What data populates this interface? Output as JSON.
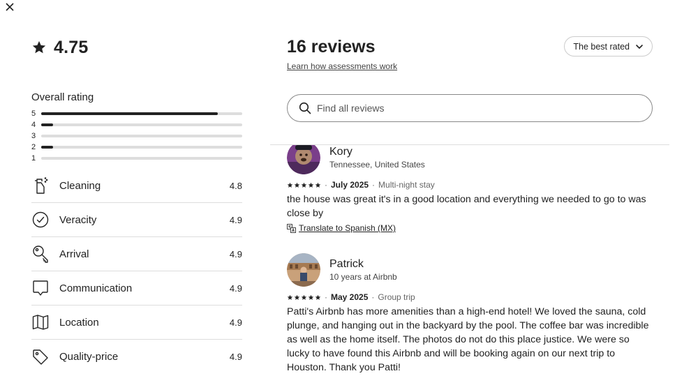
{
  "header": {
    "close_label": "Close"
  },
  "summary": {
    "average": "4.75"
  },
  "overall": {
    "title": "Overall rating",
    "bars": [
      {
        "label": "5",
        "fraction": 0.88
      },
      {
        "label": "4",
        "fraction": 0.06
      },
      {
        "label": "3",
        "fraction": 0.0
      },
      {
        "label": "2",
        "fraction": 0.06
      },
      {
        "label": "1",
        "fraction": 0.0
      }
    ]
  },
  "categories": [
    {
      "name": "Cleaning",
      "value": "4.8",
      "icon": "spray-bottle-icon"
    },
    {
      "name": "Veracity",
      "value": "4.9",
      "icon": "check-circle-icon"
    },
    {
      "name": "Arrival",
      "value": "4.9",
      "icon": "key-icon"
    },
    {
      "name": "Communication",
      "value": "4.9",
      "icon": "message-icon"
    },
    {
      "name": "Location",
      "value": "4.9",
      "icon": "map-icon"
    },
    {
      "name": "Quality-price",
      "value": "4.9",
      "icon": "tag-icon"
    }
  ],
  "reviews_panel": {
    "count_label": "16 reviews",
    "learn_link": "Learn how assessments work",
    "sort_label": "The best rated",
    "search_placeholder": "Find all reviews"
  },
  "reviews": [
    {
      "name": "Kory",
      "subtitle": "Tennessee, United States",
      "rating": 5,
      "date": "July 2025",
      "stay": "Multi-night stay",
      "text": "the house was great it's in a good location and everything we needed to go to was close by",
      "translate": "Translate to Spanish (MX)"
    },
    {
      "name": "Patrick",
      "subtitle": "10 years at Airbnb",
      "rating": 5,
      "date": "May 2025",
      "stay": "Group trip",
      "text": "Patti's Airbnb has more amenities than a high-end hotel! We loved the sauna, cold plunge, and hanging out in the backyard by the pool. The coffee bar was incredible as well as the home itself. The photos do not do this place justice. We were so lucky to have found this Airbnb and will be booking again on our next trip to Houston. Thank you Patti!"
    }
  ],
  "colors": {
    "text": "#222222",
    "bar_track": "#dddddd",
    "bar_fill": "#222222"
  }
}
